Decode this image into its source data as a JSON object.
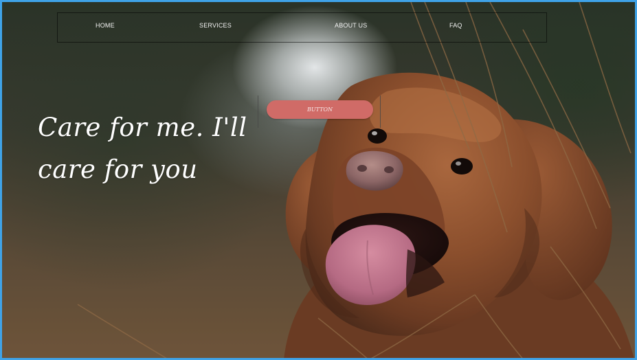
{
  "nav": {
    "items": [
      {
        "label": "HOME"
      },
      {
        "label": "SERVICES"
      },
      {
        "label": "ABOUT US"
      },
      {
        "label": "FAQ"
      }
    ]
  },
  "hero": {
    "headline_line1": "Care for me. I'll",
    "headline_line2": "care for you",
    "button_label": "BUTTON",
    "image": "golden-dog-photo"
  },
  "colors": {
    "frame_border": "#3fa3e8",
    "button_bg": "#d06b67",
    "nav_text": "#f3f3f3"
  }
}
